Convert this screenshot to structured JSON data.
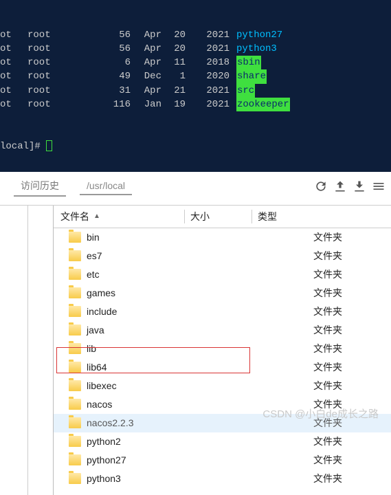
{
  "terminal": {
    "rows": [
      {
        "c1": "ot",
        "c2": "root",
        "c3": "56",
        "c4": "Apr",
        "c5": "20",
        "c6": "2021",
        "name": "python27",
        "cls": "t-link"
      },
      {
        "c1": "ot",
        "c2": "root",
        "c3": "56",
        "c4": "Apr",
        "c5": "20",
        "c6": "2021",
        "name": "python3",
        "cls": "t-link"
      },
      {
        "c1": "ot",
        "c2": "root",
        "c3": "6",
        "c4": "Apr",
        "c5": "11",
        "c6": "2018",
        "name": "sbin",
        "cls": "t-hl"
      },
      {
        "c1": "ot",
        "c2": "root",
        "c3": "49",
        "c4": "Dec",
        "c5": "1",
        "c6": "2020",
        "name": "share",
        "cls": "t-hl"
      },
      {
        "c1": "ot",
        "c2": "root",
        "c3": "31",
        "c4": "Apr",
        "c5": "21",
        "c6": "2021",
        "name": "src",
        "cls": "t-hl"
      },
      {
        "c1": "ot",
        "c2": "root",
        "c3": "116",
        "c4": "Jan",
        "c5": "19",
        "c6": "2021",
        "name": "zookeeper",
        "cls": "t-hl"
      }
    ],
    "prompt": "local]# "
  },
  "toolbar": {
    "history_label": "访问历史",
    "path": "/usr/local"
  },
  "headers": {
    "name": "文件名",
    "size": "大小",
    "type": "类型",
    "sort": "▲"
  },
  "type_folder": "文件夹",
  "files": [
    {
      "name": "bin",
      "selected": false
    },
    {
      "name": "es7",
      "selected": false
    },
    {
      "name": "etc",
      "selected": false
    },
    {
      "name": "games",
      "selected": false
    },
    {
      "name": "include",
      "selected": false
    },
    {
      "name": "java",
      "selected": false
    },
    {
      "name": "lib",
      "selected": false
    },
    {
      "name": "lib64",
      "selected": false
    },
    {
      "name": "libexec",
      "selected": false
    },
    {
      "name": "nacos",
      "selected": false
    },
    {
      "name": "nacos2.2.3",
      "selected": true
    },
    {
      "name": "python2",
      "selected": false
    },
    {
      "name": "python27",
      "selected": false
    },
    {
      "name": "python3",
      "selected": false
    }
  ],
  "watermark": "CSDN @小白de成长之路"
}
